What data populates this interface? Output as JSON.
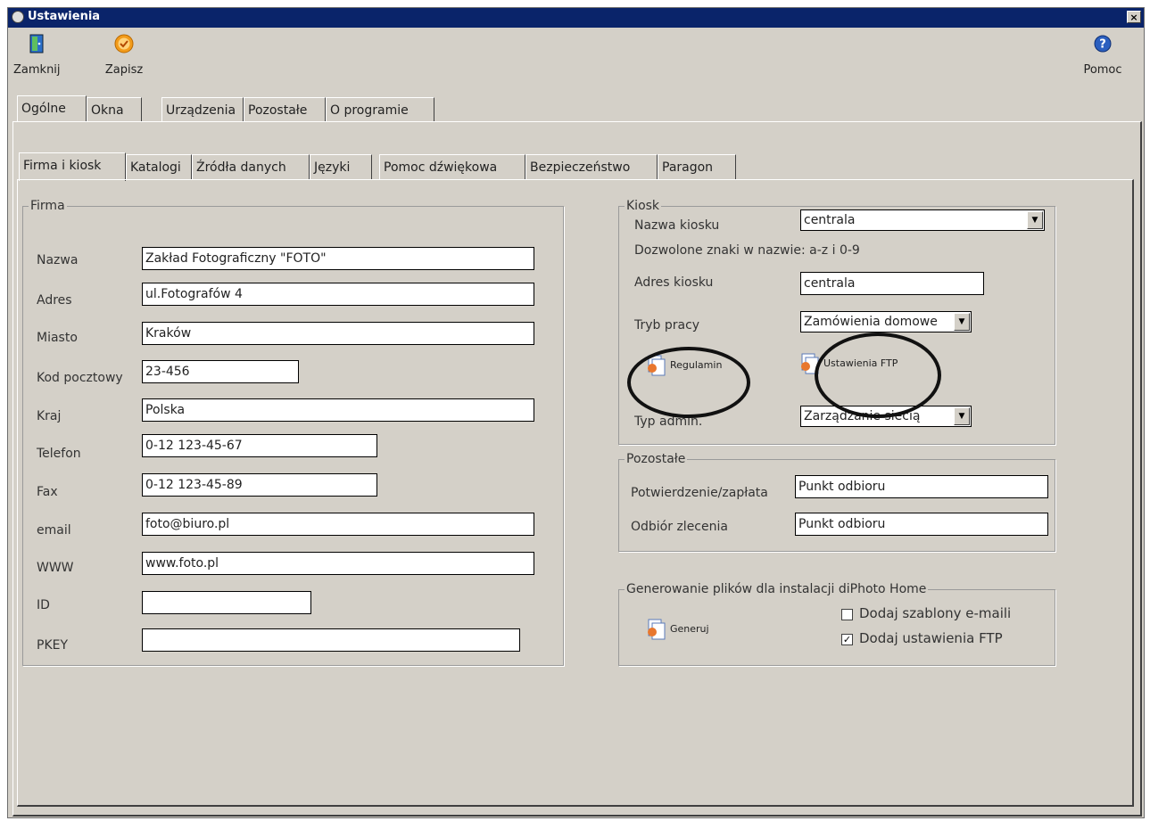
{
  "window": {
    "title": "Ustawienia",
    "close_glyph": "×"
  },
  "toolbar": {
    "close_label": "Zamknij",
    "save_label": "Zapisz",
    "help_label": "Pomoc"
  },
  "main_tabs": [
    "Ogólne",
    "Okna",
    "Urządzenia",
    "Pozostałe",
    "O programie"
  ],
  "sub_tabs": [
    "Firma i kiosk",
    "Katalogi",
    "Źródła danych",
    "Języki",
    "Pomoc dźwiękowa",
    "Bezpieczeństwo",
    "Paragon"
  ],
  "firma": {
    "legend": "Firma",
    "fields": [
      {
        "label": "Nazwa",
        "value": "Zakład Fotograficzny \"FOTO\""
      },
      {
        "label": "Adres",
        "value": "ul.Fotografów 4"
      },
      {
        "label": "Miasto",
        "value": "Kraków"
      },
      {
        "label": "Kod pocztowy",
        "value": "23-456"
      },
      {
        "label": "Kraj",
        "value": "Polska"
      },
      {
        "label": "Telefon",
        "value": "0-12 123-45-67"
      },
      {
        "label": "Fax",
        "value": "0-12 123-45-89"
      },
      {
        "label": "email",
        "value": "foto@biuro.pl"
      },
      {
        "label": "WWW",
        "value": "www.foto.pl"
      },
      {
        "label": "ID",
        "value": ""
      },
      {
        "label": "PKEY",
        "value": ""
      }
    ]
  },
  "kiosk": {
    "legend": "Kiosk",
    "name_label": "Nazwa kiosku",
    "name_value": "centrala",
    "allowed_chars": "Dozwolone znaki w nazwie: a-z i 0-9",
    "address_label": "Adres kiosku",
    "address_value": "centrala",
    "mode_label": "Tryb pracy",
    "mode_value": "Zamówienia domowe",
    "rules_button": "Regulamin",
    "ftp_button": "Ustawienia FTP",
    "admin_label": "Typ admin.",
    "admin_value": "Zarządzanie siecią"
  },
  "pozostale": {
    "legend": "Pozostałe",
    "confirm_label": "Potwierdzenie/zapłata",
    "confirm_value": "Punkt odbioru",
    "pickup_label": "Odbiór zlecenia",
    "pickup_value": "Punkt odbioru"
  },
  "generowanie": {
    "legend": "Generowanie plików dla instalacji diPhoto Home",
    "generate_button": "Generuj",
    "templates_label": "Dodaj szablony e-maili",
    "templates_checked": false,
    "ftp_settings_label": "Dodaj ustawienia FTP",
    "ftp_settings_checked": true,
    "check_glyph": "✓"
  },
  "colors": {
    "window_bg": "#d4d0c8",
    "titlebar": "#0a246a",
    "annotation": "#111111"
  }
}
